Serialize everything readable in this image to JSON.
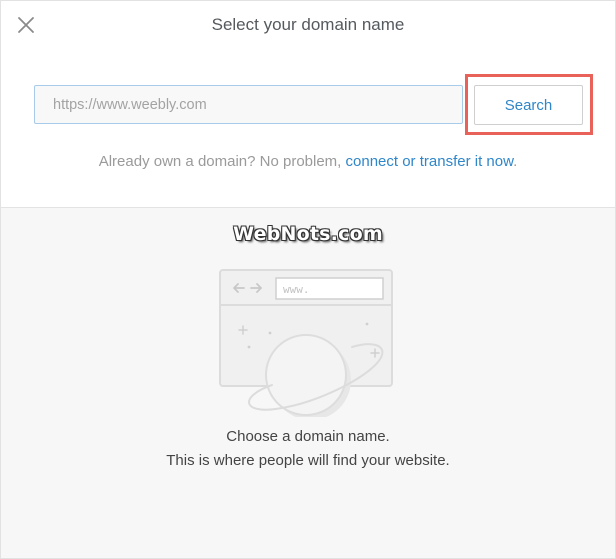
{
  "modal": {
    "title": "Select your domain name",
    "close_icon": "close-icon"
  },
  "search": {
    "placeholder": "https://www.weebly.com",
    "value": "",
    "button_label": "Search"
  },
  "own_domain": {
    "text": "Already own a domain? No problem, ",
    "link_label": "connect or transfer it now",
    "suffix": "."
  },
  "watermark": "WebNots.com",
  "illustration": {
    "icon": "browser-planet-illustration",
    "url_text": "www."
  },
  "caption": {
    "line1": "Choose a domain name.",
    "line2": "This is where people will find your website."
  },
  "colors": {
    "accent": "#2f86c9",
    "highlight": "#e8625a",
    "input_border": "#a9cbea"
  }
}
